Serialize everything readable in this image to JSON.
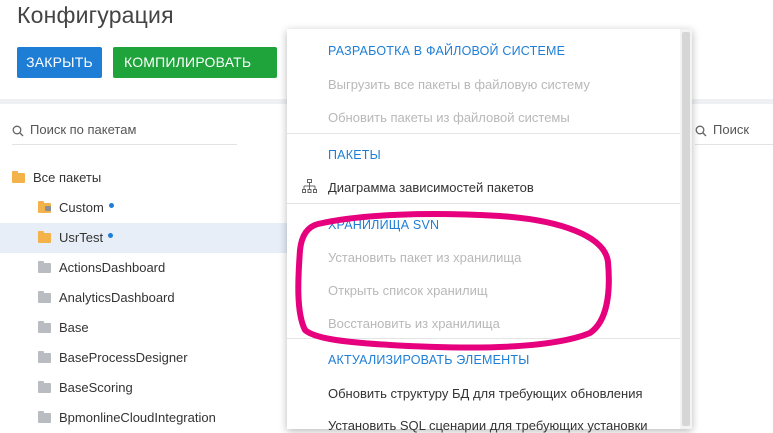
{
  "page": {
    "title": "Конфигурация"
  },
  "toolbar": {
    "close_label": "ЗАКРЫТЬ",
    "compile_label": "КОМПИЛИРОВАТЬ"
  },
  "colors": {
    "primary_blue": "#1e7ed6",
    "success_green": "#1fa33b",
    "annotation_magenta": "#e6007e"
  },
  "left_panel": {
    "search_placeholder": "Поиск по пакетам",
    "tree": [
      {
        "label": "Все пакеты",
        "icon": "folder-icon",
        "color": "yellow"
      },
      {
        "label": "Custom",
        "icon": "locked-folder-icon",
        "color": "yellow",
        "modified": true
      },
      {
        "label": "UsrTest",
        "icon": "folder-icon",
        "color": "yellow",
        "modified": true,
        "selected": true
      },
      {
        "label": "ActionsDashboard",
        "icon": "folder-icon",
        "color": "gray"
      },
      {
        "label": "AnalyticsDashboard",
        "icon": "folder-icon",
        "color": "gray"
      },
      {
        "label": "Base",
        "icon": "folder-icon",
        "color": "gray"
      },
      {
        "label": "BaseProcessDesigner",
        "icon": "folder-icon",
        "color": "gray"
      },
      {
        "label": "BaseScoring",
        "icon": "folder-icon",
        "color": "gray"
      },
      {
        "label": "BpmonlineCloudIntegration",
        "icon": "folder-icon",
        "color": "gray"
      }
    ]
  },
  "right_panel": {
    "search_placeholder": "Поиск"
  },
  "dropdown": {
    "items": [
      {
        "label": "РАЗРАБОТКА В ФАЙЛОВОЙ СИСТЕМЕ",
        "kind": "header"
      },
      {
        "label": "Выгрузить все пакеты в файловую систему",
        "kind": "disabled"
      },
      {
        "label": "Обновить пакеты из файловой системы",
        "kind": "disabled"
      },
      {
        "label": "ПАКЕТЫ",
        "kind": "header"
      },
      {
        "label": "Диаграмма зависимостей пакетов",
        "kind": "active",
        "icon": "hierarchy-icon"
      },
      {
        "label": "ХРАНИЛИЩА SVN",
        "kind": "header"
      },
      {
        "label": "Установить пакет из хранилища",
        "kind": "disabled"
      },
      {
        "label": "Открыть список хранилищ",
        "kind": "disabled"
      },
      {
        "label": "Восстановить из хранилища",
        "kind": "disabled"
      },
      {
        "label": "АКТУАЛИЗИРОВАТЬ ЭЛЕМЕНТЫ",
        "kind": "header"
      },
      {
        "label": "Обновить структуру БД для требующих обновления",
        "kind": "active"
      },
      {
        "label": "Установить SQL сценарии для требующих установки",
        "kind": "active"
      }
    ]
  }
}
